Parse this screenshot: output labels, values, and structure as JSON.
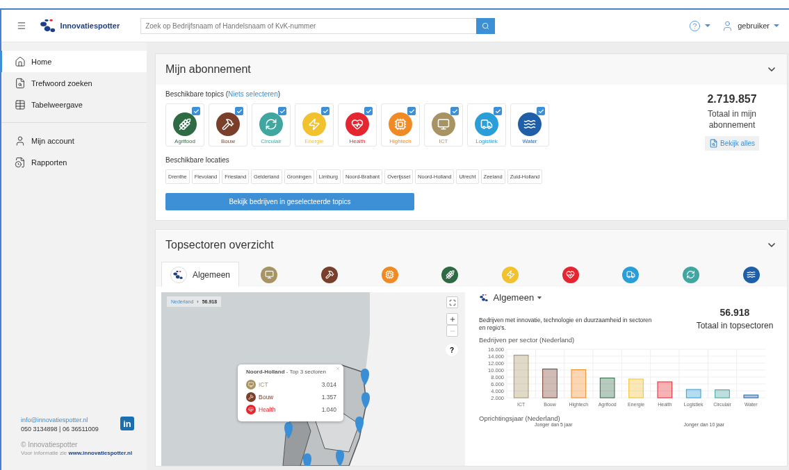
{
  "header": {
    "logo": "Innovatiespotter",
    "search": {
      "placeholder": "Zoek op Bedrijfsnaam of Handelsnaam of KvK-nummer"
    },
    "user": "gebruiker"
  },
  "sidebar": {
    "items": [
      {
        "label": "Home",
        "selected": true
      },
      {
        "label": "Trefwoord zoeken",
        "selected": false
      },
      {
        "label": "Tabelweergave",
        "selected": false
      }
    ],
    "account_items": [
      {
        "label": "Mijn account",
        "selected": false
      },
      {
        "label": "Rapporten",
        "selected": false
      }
    ],
    "footer": {
      "email": "info@innovatiespotter.nl",
      "phone": "050 3134898 | 06 36511009",
      "copyright": "© Innovatiespotter",
      "info": "Voor informatie zie",
      "website": "www.innovatiespotter.nl",
      "linkedin": "in"
    }
  },
  "subscription": {
    "title": "Mijn abonnement",
    "topics_label": "Beschikbare topics (",
    "topics_link": "Niets selecteren",
    "topics_close": ")",
    "topics": [
      {
        "label": "Agrifood",
        "color": "#2e6b45",
        "checked": true
      },
      {
        "label": "Bouw",
        "color": "#7a3f2b",
        "checked": true
      },
      {
        "label": "Circulair",
        "color": "#3fa6a0",
        "checked": true
      },
      {
        "label": "Energie",
        "color": "#f2c12e",
        "checked": true
      },
      {
        "label": "Health",
        "color": "#e3262f",
        "checked": true
      },
      {
        "label": "Hightech",
        "color": "#f08a24",
        "checked": true
      },
      {
        "label": "ICT",
        "color": "#a89462",
        "checked": true
      },
      {
        "label": "Logistiek",
        "color": "#2a9ed8",
        "checked": true
      },
      {
        "label": "Water",
        "color": "#1f5fa8",
        "checked": true
      }
    ],
    "locations_label": "Beschikbare locaties",
    "locations": [
      "Drenthe",
      "Flevoland",
      "Friesland",
      "Gelderland",
      "Groningen",
      "Limburg",
      "Noord-Brabant",
      "Overijssel",
      "Noord-Holland",
      "Utrecht",
      "Zeeland",
      "Zuid-Holland"
    ],
    "button": "Bekijk bedrijven in geselecteerde topics",
    "total": "2.719.857",
    "total_label": "Totaal in mijn abonnement",
    "view_all": "Bekijk alles"
  },
  "overview": {
    "title": "Topsectoren overzicht",
    "tabs": [
      {
        "label": "Algemeen",
        "selected": true
      },
      {
        "color": "#a89462",
        "selected": false
      },
      {
        "color": "#7a3f2b",
        "selected": false
      },
      {
        "color": "#f08a24",
        "selected": false
      },
      {
        "color": "#2e6b45",
        "selected": false
      },
      {
        "color": "#f2c12e",
        "selected": false
      },
      {
        "color": "#e3262f",
        "selected": false
      },
      {
        "color": "#2a9ed8",
        "selected": false
      },
      {
        "color": "#3fa6a0",
        "selected": false
      },
      {
        "color": "#1f5fa8",
        "selected": false
      }
    ],
    "map": {
      "breadcrumb_link": "Nederland",
      "breadcrumb_separator": "›",
      "breadcrumb_count": "56.918",
      "help": "?",
      "popup": {
        "title": "**Noord-Holland** - Top 3 sectoren",
        "rows": [
          {
            "label": "ICT",
            "value": "3.014",
            "color": "#a89462"
          },
          {
            "label": "Bouw",
            "value": "1.357",
            "color": "#7a3f2b"
          },
          {
            "label": "Health",
            "value": "1.040",
            "color": "#e3262f"
          }
        ]
      }
    },
    "dropdown": "Algemeen",
    "description": "Bedrijven met innovatie, technologie en duurzaamheid in sectoren en regio's.",
    "total": "56.918",
    "total_label": "Totaal in topsectoren",
    "chart_title": "Bedrijven per sector (Nederland)",
    "chart_data": {
      "type": "bar",
      "categories": [
        "ICT",
        "Bouw",
        "Hightech",
        "Agrifood",
        "Energie",
        "Health",
        "Logistiek",
        "Circulair",
        "Water"
      ],
      "grid": true,
      "series": [
        {
          "values": [
            14300,
            10300,
            10100,
            7700,
            7400,
            6600,
            4400,
            4300,
            2800
          ]
        }
      ],
      "ylim": [
        2000,
        16000
      ],
      "yticks": [
        {
          "value": 2000,
          "label": "2.000"
        },
        {
          "value": 4000,
          "label": "4.000"
        },
        {
          "value": 6000,
          "label": "6.000"
        },
        {
          "value": 8000,
          "label": "8.000"
        },
        {
          "value": 10000,
          "label": "10.000"
        },
        {
          "value": 12000,
          "label": "12.000"
        },
        {
          "value": 14000,
          "label": "14.000"
        },
        {
          "value": 16000,
          "label": "16.000"
        }
      ]
    },
    "founding_title": "Oprichtingsjaar (Nederland)",
    "founding_labels": [
      "Jonger dan 5 jaar",
      "Jonger dan 10 jaar"
    ]
  }
}
